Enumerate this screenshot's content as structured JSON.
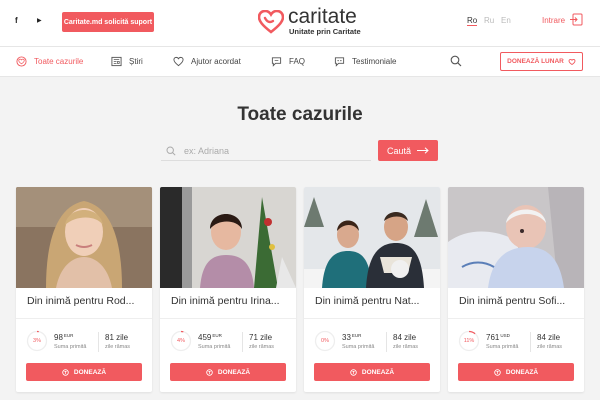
{
  "topbar": {
    "social": [
      "f",
      "▶"
    ],
    "support_label": "Caritate.md solicită suport",
    "logo_name": "caritate",
    "logo_tagline": "Unitate prin Caritate",
    "languages": [
      "Ro",
      "Ru",
      "En"
    ],
    "active_language": "Ro",
    "login_label": "Intrare"
  },
  "nav": {
    "items": [
      {
        "label": "Toate cazurile",
        "icon": "heart-circle-icon",
        "active": true
      },
      {
        "label": "Știri",
        "icon": "newspaper-icon",
        "active": false
      },
      {
        "label": "Ajutor acordat",
        "icon": "heart-icon",
        "active": false
      },
      {
        "label": "FAQ",
        "icon": "chat-bubble-icon",
        "active": false
      },
      {
        "label": "Testimoniale",
        "icon": "quote-bubble-icon",
        "active": false
      }
    ],
    "donate_monthly_label": "DONEAZĂ LUNAR"
  },
  "main": {
    "title": "Toate cazurile",
    "search_placeholder": "ex: Adriana",
    "search_value": "",
    "search_button": "Caută"
  },
  "cards": [
    {
      "title": "Din inimă pentru Rod...",
      "percent": 3,
      "percent_label": "3%",
      "amount": "98",
      "currency": "EUR",
      "amount_label": "Suma primită",
      "days": "81 zile",
      "days_label": "zile rămas",
      "donate_label": "DONEAZĂ"
    },
    {
      "title": "Din inimă pentru Irina...",
      "percent": 4,
      "percent_label": "4%",
      "amount": "459",
      "currency": "EUR",
      "amount_label": "Suma primită",
      "days": "71 zile",
      "days_label": "zile rămas",
      "donate_label": "DONEAZĂ"
    },
    {
      "title": "Din inimă pentru Nat...",
      "percent": 0,
      "percent_label": "0%",
      "amount": "33",
      "currency": "EUR",
      "amount_label": "Suma primită",
      "days": "84 zile",
      "days_label": "zile rămas",
      "donate_label": "DONEAZĂ"
    },
    {
      "title": "Din inimă pentru Sofi...",
      "percent": 11,
      "percent_label": "11%",
      "amount": "761",
      "currency": "USD",
      "amount_label": "Suma primită",
      "days": "84 zile",
      "days_label": "zile rămas",
      "donate_label": "DONEAZĂ"
    }
  ],
  "colors": {
    "accent": "#f15a5f",
    "background": "#f3f3f3",
    "text": "#333333"
  }
}
